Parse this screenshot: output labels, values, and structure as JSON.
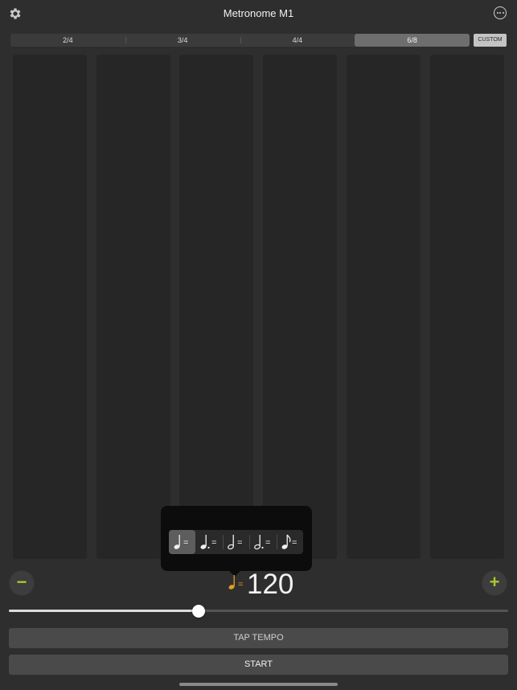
{
  "app": {
    "title": "Metronome M1"
  },
  "time_signatures": {
    "options": [
      "2/4",
      "3/4",
      "4/4",
      "6/8"
    ],
    "selected": "6/8",
    "custom_label": "CUSTOM"
  },
  "beats": {
    "count": 6
  },
  "note_picker": {
    "equals": "=",
    "options": [
      {
        "icon": "quarter-note-icon",
        "dotted": false,
        "selected": true
      },
      {
        "icon": "dotted-quarter-note-icon",
        "dotted": true,
        "selected": false
      },
      {
        "icon": "half-note-icon",
        "dotted": false,
        "selected": false
      },
      {
        "icon": "dotted-half-note-icon",
        "dotted": true,
        "selected": false
      },
      {
        "icon": "eighth-note-icon",
        "dotted": false,
        "selected": false
      }
    ]
  },
  "tempo": {
    "value": "120",
    "equals": "=",
    "note_icon": "quarter-note-icon",
    "decrease_label": "−",
    "increase_label": "+",
    "slider_fraction": 0.38
  },
  "buttons": {
    "tap_tempo": "TAP TEMPO",
    "start": "START"
  },
  "colors": {
    "accent_green": "#a6c830",
    "accent_orange": "#e0a020"
  }
}
